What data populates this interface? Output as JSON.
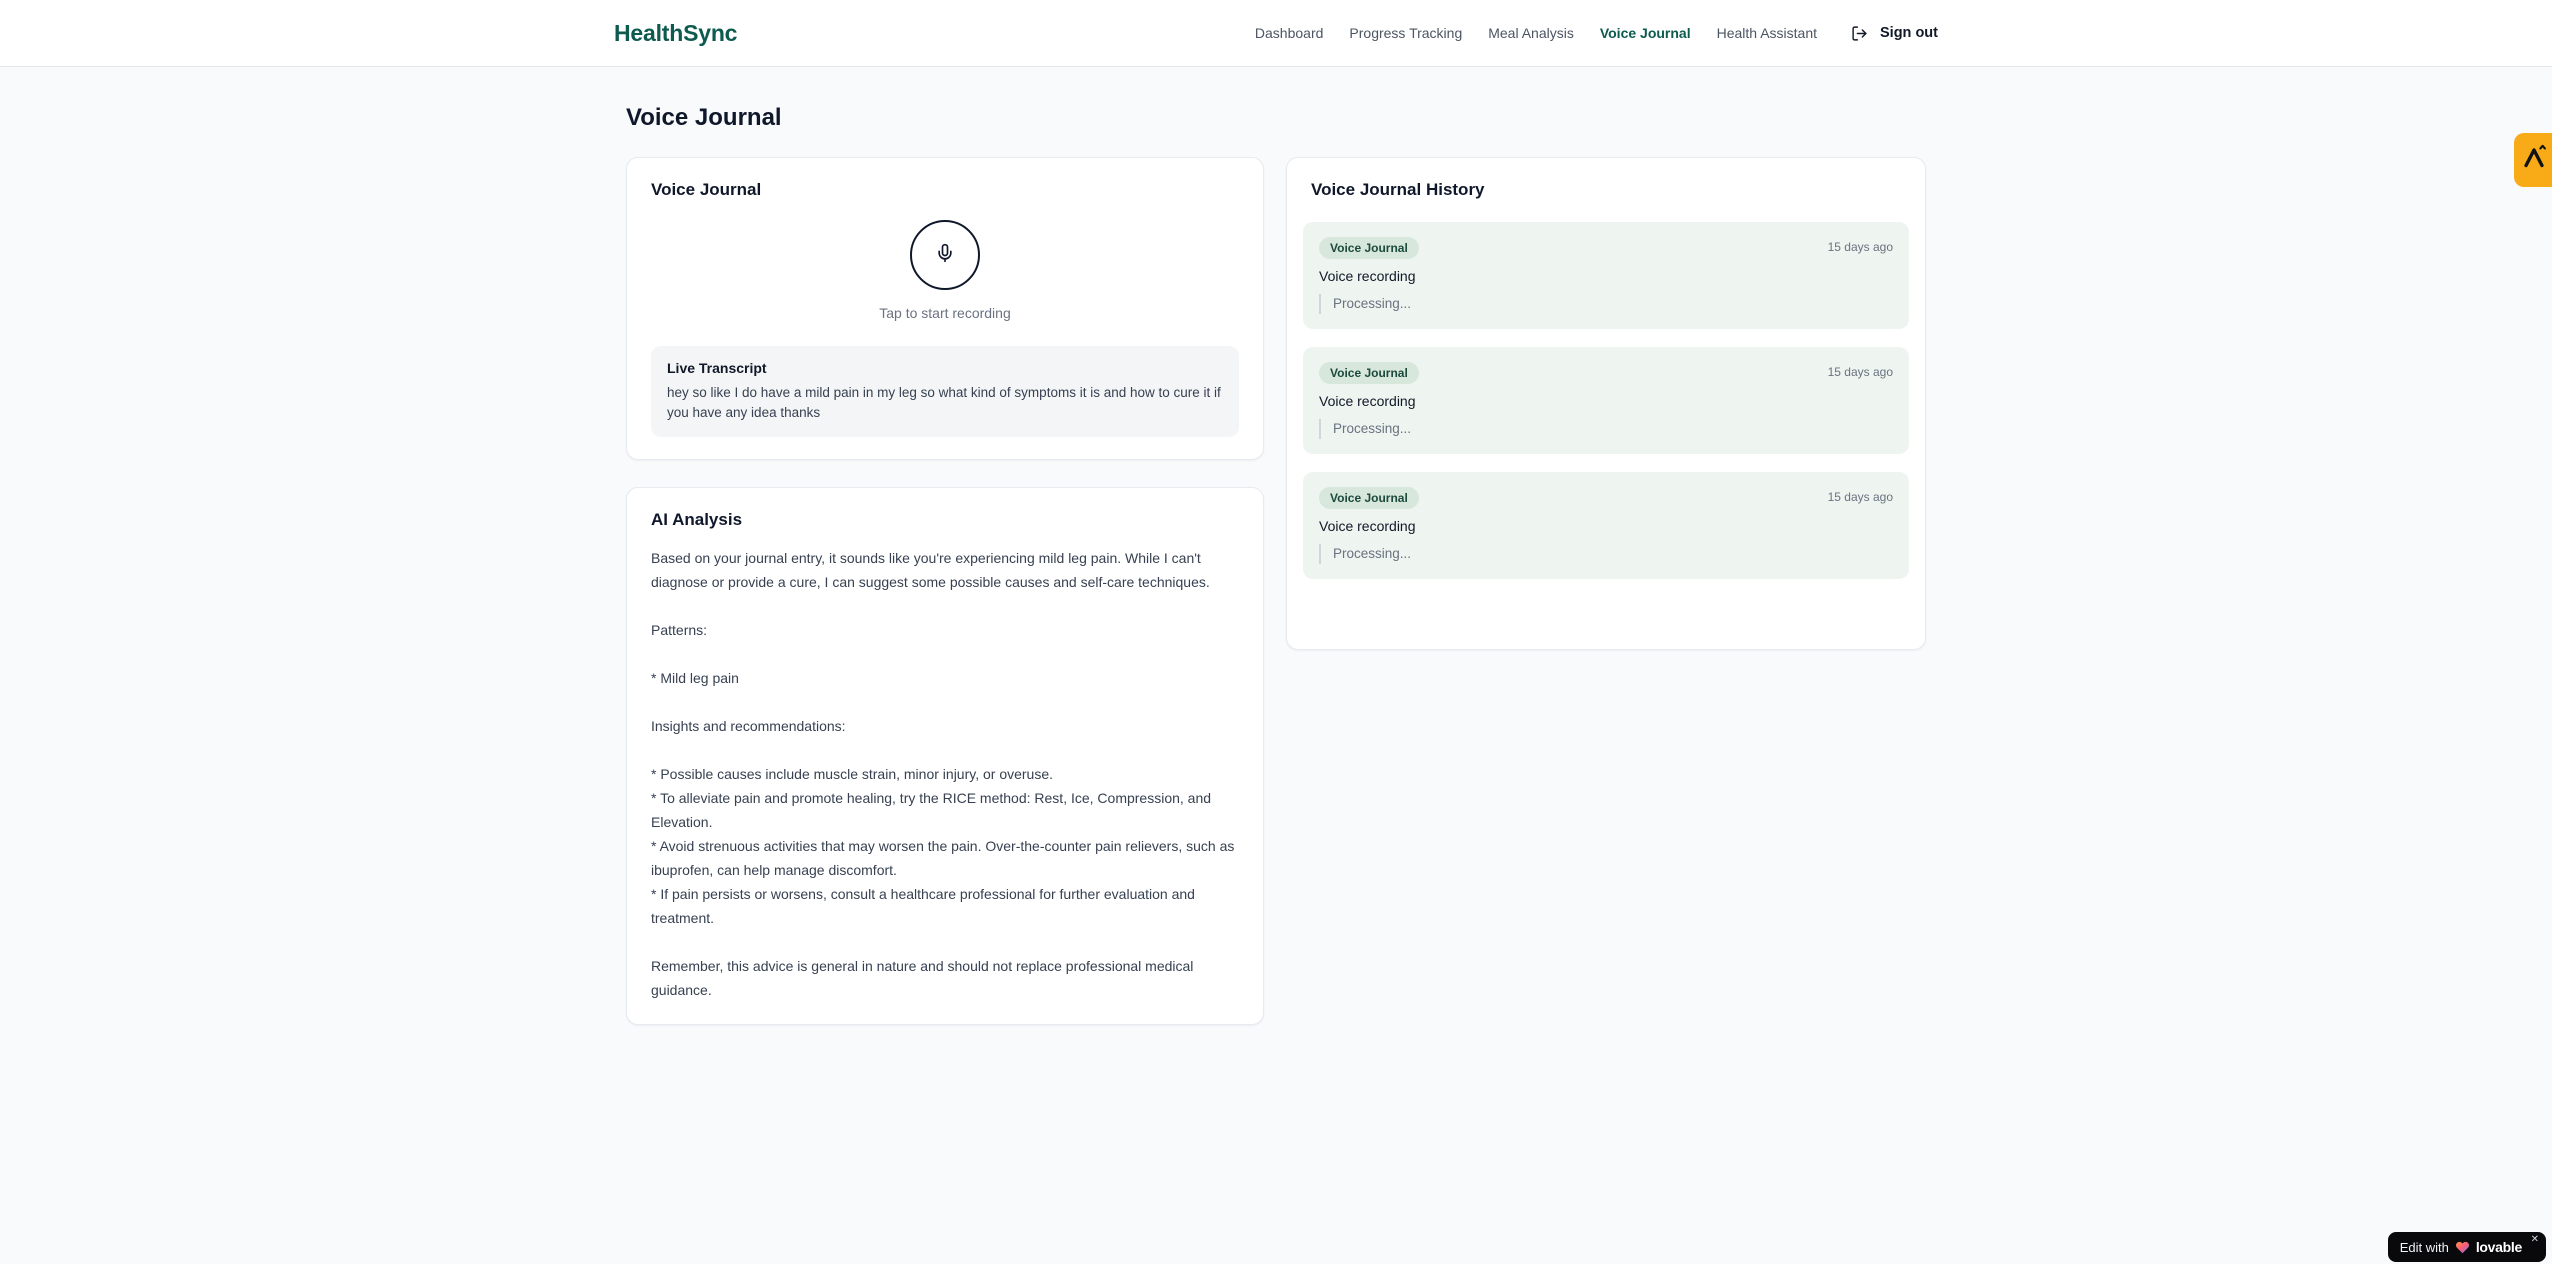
{
  "brand": {
    "name": "HealthSync"
  },
  "nav": {
    "items": [
      {
        "label": "Dashboard"
      },
      {
        "label": "Progress Tracking"
      },
      {
        "label": "Meal Analysis"
      },
      {
        "label": "Voice Journal"
      },
      {
        "label": "Health Assistant"
      }
    ],
    "sign_out_label": "Sign out"
  },
  "page": {
    "title": "Voice Journal"
  },
  "recorder_card": {
    "title": "Voice Journal",
    "mic_icon": "microphone-icon",
    "tap_hint": "Tap to start recording",
    "transcript_label": "Live Transcript",
    "transcript_text": "hey so like I do have a mild pain in my leg so what kind of symptoms it is and how to cure it if you have any idea thanks"
  },
  "analysis_card": {
    "title": "AI Analysis",
    "body": "Based on your journal entry, it sounds like you're experiencing mild leg pain. While I can't diagnose or provide a cure, I can suggest some possible causes and self-care techniques.\n\nPatterns:\n\n* Mild leg pain\n\nInsights and recommendations:\n\n* Possible causes include muscle strain, minor injury, or overuse.\n* To alleviate pain and promote healing, try the RICE method: Rest, Ice, Compression, and Elevation.\n* Avoid strenuous activities that may worsen the pain. Over-the-counter pain relievers, such as ibuprofen, can help manage discomfort.\n* If pain persists or worsens, consult a healthcare professional for further evaluation and treatment.\n\nRemember, this advice is general in nature and should not replace professional medical guidance."
  },
  "history": {
    "title": "Voice Journal History",
    "entries": [
      {
        "badge": "Voice Journal",
        "time": "15 days ago",
        "label": "Voice recording",
        "status": "Processing..."
      },
      {
        "badge": "Voice Journal",
        "time": "15 days ago",
        "label": "Voice recording",
        "status": "Processing..."
      },
      {
        "badge": "Voice Journal",
        "time": "15 days ago",
        "label": "Voice recording",
        "status": "Processing..."
      }
    ]
  },
  "widgets": {
    "lovable": {
      "prefix": "Edit with",
      "brand": "lovable",
      "close": "✕"
    }
  },
  "colors": {
    "accent_teal": "#0d5a4e",
    "page_bg": "#f8fafc",
    "entry_bg": "#eef4ef",
    "badge_bg": "#d8e7db",
    "badge_text": "#1b4a3c",
    "amber_tab": "#f8ab17",
    "lovable_bg": "#09090b"
  }
}
